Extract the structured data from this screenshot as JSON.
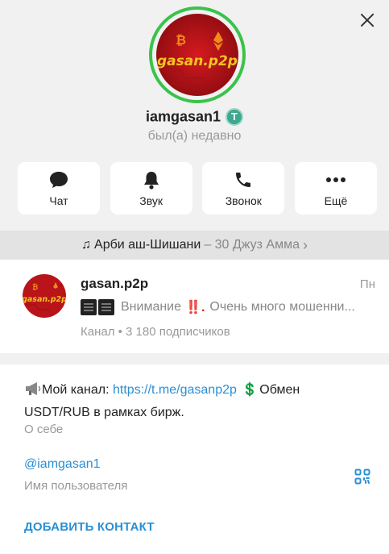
{
  "profile": {
    "username": "iamgasan1",
    "status": "был(а) недавно",
    "avatar_text": "gasan.p2p",
    "badge_symbol": "T",
    "badge_color": "#3fa78f"
  },
  "actions": [
    {
      "label": "Чат",
      "icon": "chat-bubble-icon"
    },
    {
      "label": "Звук",
      "icon": "bell-icon"
    },
    {
      "label": "Звонок",
      "icon": "phone-icon"
    },
    {
      "label": "Ещё",
      "icon": "more-dots-icon"
    }
  ],
  "music": {
    "note": "♫",
    "title": "Арби аш-Шишани",
    "subtitle": "– 30 Джуз Амма",
    "chevron": "›"
  },
  "channel": {
    "name": "gasan.p2p",
    "time": "Пн",
    "message_text": "Внимание",
    "message_bangs": "‼️.",
    "message_rest": "Очень много мошенни...",
    "info": "Канал • 3 180 подписчиков",
    "avatar_text": "gasan.p2p"
  },
  "bio": {
    "prefix": "Мой канал:",
    "link": "https://t.me/gasanp2p",
    "dollar": "💲",
    "rest": "Обмен USDT/RUB в рамках бирж.",
    "label": "О себе"
  },
  "username_field": {
    "value": "@iamgasan1",
    "label": "Имя пользователя"
  },
  "add_contact": "ДОБАВИТЬ КОНТАКТ",
  "colors": {
    "accent": "#2a8fd6",
    "ring": "#39c34a",
    "avatar_bg": "#c4121a",
    "avatar_text": "#f3c51c",
    "warning": "#e0221a"
  }
}
